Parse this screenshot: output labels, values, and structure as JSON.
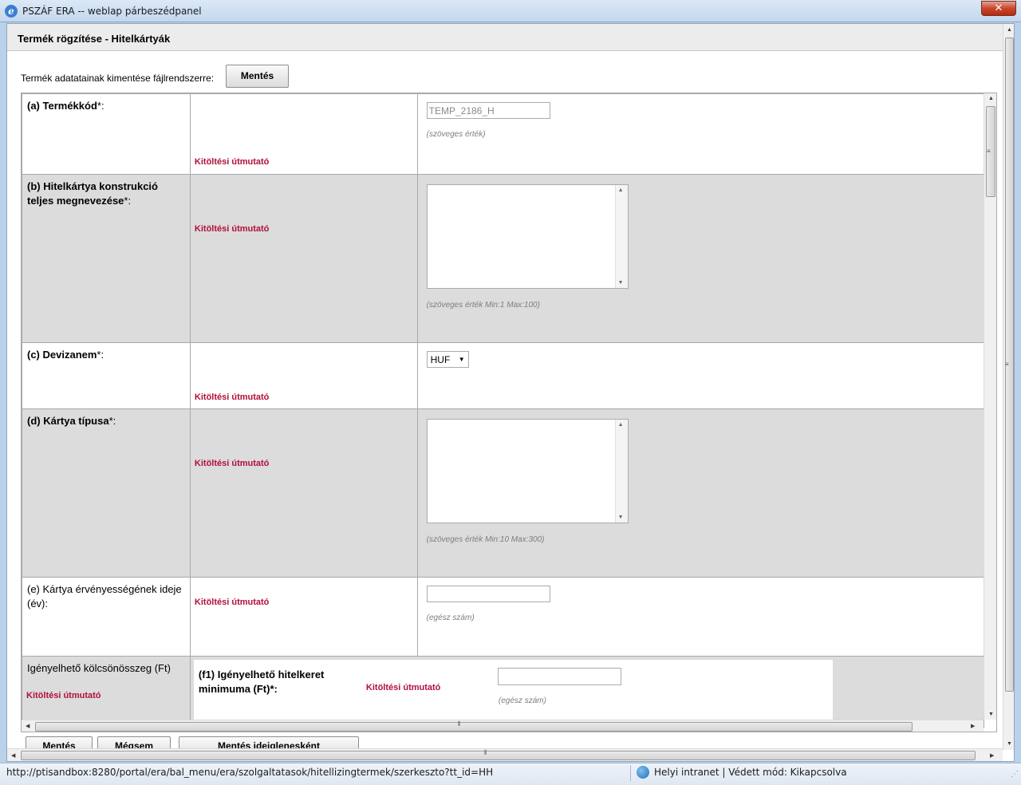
{
  "window": {
    "title": "PSZÁF ERA -- weblap párbeszédpanel",
    "close_glyph": "✕"
  },
  "page": {
    "heading": "Termék rögzítése - Hitelkártyák",
    "save_label": "Termék adatatainak kimentése fájlrendszerre:",
    "save_button": "Mentés"
  },
  "form": {
    "guide_text": "Kitöltési útmutató",
    "rows": [
      {
        "key": "(a) Termékkód",
        "star": "*:",
        "input_value": "TEMP_2186_H",
        "hint": "(szöveges érték)"
      },
      {
        "key": "(b) Hitelkártya konstrukció teljes megnevezése",
        "star": "*:",
        "hint": "(szöveges érték Min:1 Max:100)"
      },
      {
        "key": "(c) Devizanem",
        "star": "*:",
        "selected": "HUF"
      },
      {
        "key": "(d) Kártya típusa",
        "star": "*:",
        "hint": "(szöveges érték Min:10 Max:300)"
      },
      {
        "key": "(e) Kártya érvényességének ideje (év):",
        "star": "",
        "input_value": "",
        "hint": "(egész szám)"
      }
    ],
    "group": {
      "label": "Igényelhető kölcsönösszeg (Ft)",
      "sub_label": "(f1) Igényelhető hitelkeret minimuma (Ft)*:",
      "input_value": "",
      "hint": "(egész szám)"
    }
  },
  "bottom_buttons": [
    "Mentés",
    "Mégsem",
    "Mentés ideiglenesként"
  ],
  "status": {
    "url": "http://ptisandbox:8280/portal/era/bal_menu/era/szolgaltatasok/hitellizingtermek/szerkeszto?tt_id=HH",
    "zone": "Helyi intranet | Védett mód: Kikapcsolva"
  }
}
